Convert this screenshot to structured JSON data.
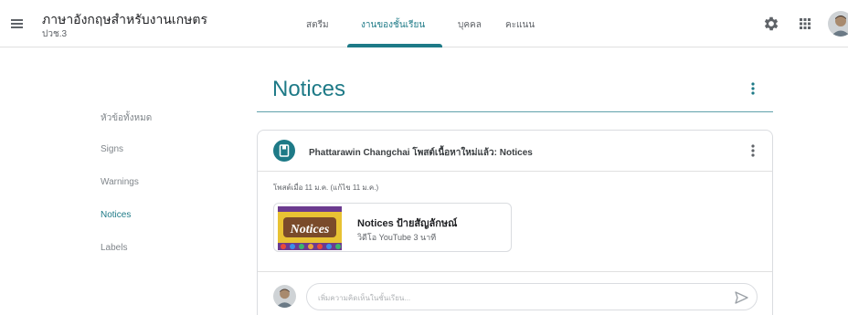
{
  "header": {
    "course_title": "ภาษาอังกฤษสำหรับงานเกษตร",
    "course_subtitle": "ปวช.3",
    "tabs": [
      {
        "label": "สตรีม"
      },
      {
        "label": "งานของชั้นเรียน"
      },
      {
        "label": "บุคคล"
      },
      {
        "label": "คะแนน"
      }
    ],
    "active_tab": "งานของชั้นเรียน",
    "icons": [
      "menu-icon",
      "gear-icon",
      "apps-icon",
      "avatar"
    ]
  },
  "sidebar": {
    "items": [
      {
        "label": "หัวข้อทั้งหมด"
      },
      {
        "label": "Signs"
      },
      {
        "label": "Warnings"
      },
      {
        "label": "Notices"
      },
      {
        "label": "Labels"
      }
    ],
    "active": "Notices"
  },
  "main": {
    "title": "Notices",
    "post": {
      "title": "Phattarawin Changchai โพสต์เนื้อหาใหม่แล้ว: Notices",
      "date": "โพสต์เมื่อ 11 ม.ค. (แก้ไข 11 ม.ค.)",
      "attachment": {
        "title": "Notices ป้ายสัญลักษณ์",
        "meta": "วิดีโอ YouTube   3 นาที",
        "thumbnail_text": "Notices"
      },
      "comment_placeholder": "เพิ่มความคิดเห็นในชั้นเรียน..."
    }
  },
  "colors": {
    "accent": "#1e7a87",
    "thumbnail_bg": "#e8c233"
  }
}
